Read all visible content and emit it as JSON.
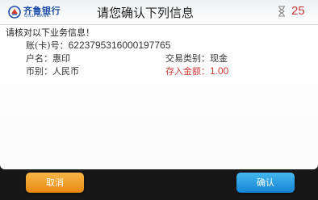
{
  "header": {
    "bank_name_cn": "齐鲁银行",
    "bank_name_en": "QILU BANK",
    "title": "请您确认下列信息",
    "countdown": "25",
    "brand_color": "#1f4fa8"
  },
  "form": {
    "prompt": "请核对以下业务信息！",
    "account_label": "账(卡)号：",
    "account_number": "6223795316000197765",
    "name_label": "户名：",
    "name_value": "惠印",
    "transaction_type_label": "交易类别：",
    "transaction_type_value": "现金",
    "currency_label": "币别：",
    "currency_value": "人民币",
    "deposit_amount_label": "存入金额：",
    "deposit_amount_value": "1.00",
    "amount_color": "#d23a3a"
  },
  "buttons": {
    "cancel_label": "取消",
    "confirm_label": "确认",
    "cancel_color": "#f0a030",
    "confirm_color": "#2a9de6"
  },
  "icons": {
    "logo": "qilu-bank-logo-icon",
    "timer": "hourglass-timer-icon"
  }
}
